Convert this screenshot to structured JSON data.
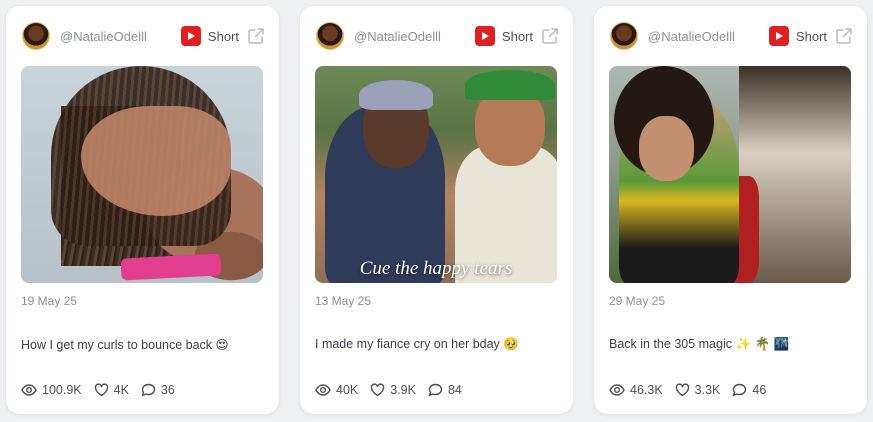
{
  "cards": [
    {
      "handle": "@NatalieOdelll",
      "type_label": "Short",
      "date": "19 May 25",
      "caption": "How I get my curls to bounce back 😍",
      "thumbnail_caption": "",
      "stats": {
        "views": "100.9K",
        "likes": "4K",
        "comments": "36"
      }
    },
    {
      "handle": "@NatalieOdelll",
      "type_label": "Short",
      "date": "13 May 25",
      "caption": "I made my fiance cry on her bday 🥹",
      "thumbnail_caption": "Cue the happy tears",
      "stats": {
        "views": "40K",
        "likes": "3.9K",
        "comments": "84"
      }
    },
    {
      "handle": "@NatalieOdelll",
      "type_label": "Short",
      "date": "29 May 25",
      "caption": "Back in the 305 magic ✨ 🌴 🌃",
      "thumbnail_caption": "",
      "stats": {
        "views": "46.3K",
        "likes": "3.3K",
        "comments": "46"
      }
    }
  ],
  "icons": {
    "platform": "youtube-icon",
    "external": "external-link-icon",
    "views": "eye-icon",
    "likes": "heart-icon",
    "comments": "comment-icon"
  },
  "colors": {
    "youtube_red": "#e02020",
    "card_bg": "#ffffff",
    "page_bg": "#eef0f4",
    "muted_text": "#8b909a"
  }
}
